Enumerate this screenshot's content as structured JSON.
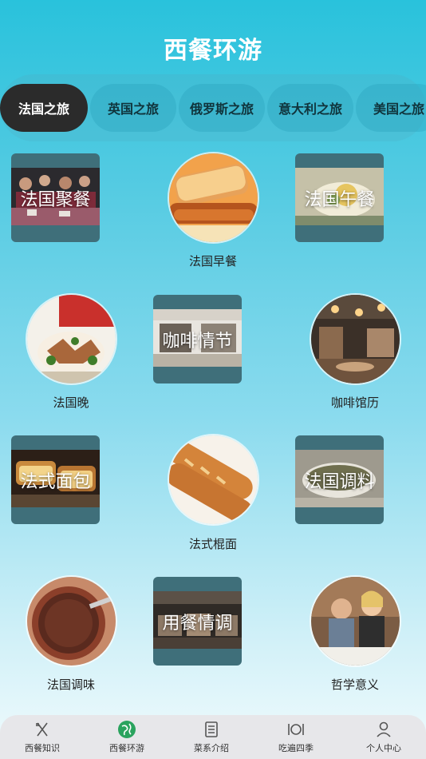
{
  "header": {
    "title": "西餐环游"
  },
  "tabs": [
    {
      "label": "法国之旅",
      "active": true
    },
    {
      "label": "英国之旅",
      "active": false
    },
    {
      "label": "俄罗斯之旅",
      "active": false
    },
    {
      "label": "意大利之旅",
      "active": false
    },
    {
      "label": "美国之旅",
      "active": false
    }
  ],
  "grid": [
    {
      "label": "法国聚餐",
      "style": "square",
      "icon": "group-dinner-photo"
    },
    {
      "label": "法国早餐",
      "style": "circle",
      "icon": "toast-breakfast-photo"
    },
    {
      "label": "法国午餐",
      "style": "square",
      "icon": "lunch-dish-photo"
    },
    {
      "label": "法国晚",
      "style": "circle",
      "icon": "lamb-dinner-photo"
    },
    {
      "label": "咖啡情节",
      "style": "square",
      "icon": "cafe-storefront-photo"
    },
    {
      "label": "咖啡馆历",
      "style": "circle",
      "icon": "cafe-interior-photo"
    },
    {
      "label": "法式面包",
      "style": "square",
      "icon": "bread-loaf-photo"
    },
    {
      "label": "法式棍面",
      "style": "circle",
      "icon": "baguette-photo"
    },
    {
      "label": "法国调料",
      "style": "square",
      "icon": "spice-bowl-photo"
    },
    {
      "label": "法国调味",
      "style": "circle",
      "icon": "chocolate-sauce-photo"
    },
    {
      "label": "用餐情调",
      "style": "square",
      "icon": "restaurant-hall-photo"
    },
    {
      "label": "哲学意义",
      "style": "circle",
      "icon": "couple-cafe-photo"
    }
  ],
  "bottom_nav": [
    {
      "label": "西餐知识",
      "icon": "fork-knife-icon",
      "active": false
    },
    {
      "label": "西餐环游",
      "icon": "globe-icon",
      "active": true
    },
    {
      "label": "菜系介绍",
      "icon": "menu-list-icon",
      "active": false
    },
    {
      "label": "吃遍四季",
      "icon": "plate-cutlery-icon",
      "active": false
    },
    {
      "label": "个人中心",
      "icon": "person-icon",
      "active": false
    }
  ],
  "colors": {
    "bg_top": "#29c2dc",
    "bg_bottom": "#f1fbfd",
    "tab_active": "#2b2b2b",
    "nav_active": "#2aa35e"
  }
}
